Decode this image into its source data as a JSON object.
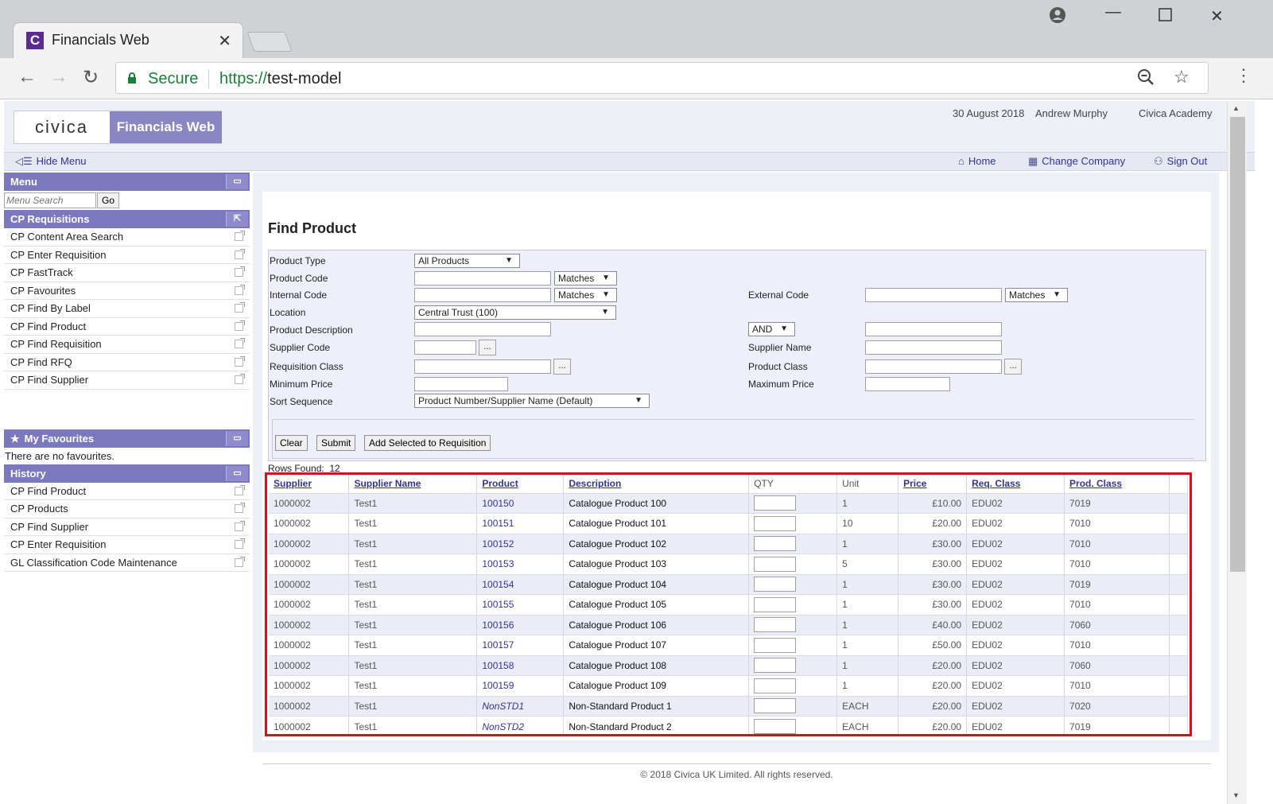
{
  "browser": {
    "tab_title": "Financials Web",
    "favicon_letter": "C",
    "secure_label": "Secure",
    "url_scheme": "https://",
    "url_host": "test-model"
  },
  "header": {
    "logo_text": "civica",
    "app_name": "Financials Web",
    "date": "30 August 2018",
    "user": "Andrew Murphy",
    "company": "Civica Academy"
  },
  "navbar": {
    "hide_menu": "Hide Menu",
    "home": "Home",
    "change_company": "Change Company",
    "sign_out": "Sign Out"
  },
  "sidebar": {
    "menu_title": "Menu",
    "search_placeholder": "Menu Search",
    "go_label": "Go",
    "requisitions_title": "CP Requisitions",
    "requisitions_items": [
      "CP Content Area Search",
      "CP Enter Requisition",
      "CP FastTrack",
      "CP Favourites",
      "CP Find By Label",
      "CP Find Product",
      "CP Find Requisition",
      "CP Find RFQ",
      "CP Find Supplier"
    ],
    "favourites_title": "My Favourites",
    "favourites_empty": "There are no favourites.",
    "history_title": "History",
    "history_items": [
      "CP Find Product",
      "CP Products",
      "CP Find Supplier",
      "CP Enter Requisition",
      "GL Classification Code Maintenance"
    ]
  },
  "form": {
    "title": "Find Product",
    "labels": {
      "product_type": "Product Type",
      "product_code": "Product Code",
      "internal_code": "Internal Code",
      "location": "Location",
      "product_description": "Product Description",
      "supplier_code": "Supplier Code",
      "requisition_class": "Requisition Class",
      "minimum_price": "Minimum Price",
      "sort_sequence": "Sort Sequence",
      "external_code": "External Code",
      "supplier_name": "Supplier Name",
      "product_class": "Product Class",
      "maximum_price": "Maximum Price"
    },
    "values": {
      "product_type": "All Products",
      "product_code_match": "Matches",
      "internal_code_match": "Matches",
      "external_code_match": "Matches",
      "location": "Central Trust (100)",
      "description_op": "AND",
      "sort_sequence": "Product Number/Supplier Name (Default)",
      "dots": "..."
    },
    "buttons": {
      "clear": "Clear",
      "submit": "Submit",
      "add_selected": "Add Selected to Requisition"
    },
    "rows_found_label": "Rows Found:",
    "rows_found_value": "12"
  },
  "table": {
    "headers": [
      "Supplier",
      "Supplier Name",
      "Product",
      "Description",
      "QTY",
      "Unit",
      "Price",
      "Req. Class",
      "Prod. Class"
    ],
    "rows": [
      [
        "1000002",
        "Test1",
        "100150",
        "Catalogue Product 100",
        "",
        "1",
        "£10.00",
        "EDU02",
        "7019"
      ],
      [
        "1000002",
        "Test1",
        "100151",
        "Catalogue Product 101",
        "",
        "10",
        "£20.00",
        "EDU02",
        "7010"
      ],
      [
        "1000002",
        "Test1",
        "100152",
        "Catalogue Product 102",
        "",
        "1",
        "£30.00",
        "EDU02",
        "7010"
      ],
      [
        "1000002",
        "Test1",
        "100153",
        "Catalogue Product 103",
        "",
        "5",
        "£30.00",
        "EDU02",
        "7010"
      ],
      [
        "1000002",
        "Test1",
        "100154",
        "Catalogue Product 104",
        "",
        "1",
        "£30.00",
        "EDU02",
        "7019"
      ],
      [
        "1000002",
        "Test1",
        "100155",
        "Catalogue Product 105",
        "",
        "1",
        "£30.00",
        "EDU02",
        "7010"
      ],
      [
        "1000002",
        "Test1",
        "100156",
        "Catalogue Product 106",
        "",
        "1",
        "£40.00",
        "EDU02",
        "7060"
      ],
      [
        "1000002",
        "Test1",
        "100157",
        "Catalogue Product 107",
        "",
        "1",
        "£50.00",
        "EDU02",
        "7010"
      ],
      [
        "1000002",
        "Test1",
        "100158",
        "Catalogue Product 108",
        "",
        "1",
        "£20.00",
        "EDU02",
        "7060"
      ],
      [
        "1000002",
        "Test1",
        "100159",
        "Catalogue Product 109",
        "",
        "1",
        "£20.00",
        "EDU02",
        "7010"
      ],
      [
        "1000002",
        "Test1",
        "NonSTD1",
        "Non-Standard Product 1",
        "",
        "EACH",
        "£20.00",
        "EDU02",
        "7020"
      ],
      [
        "1000002",
        "Test1",
        "NonSTD2",
        "Non-Standard Product 2",
        "",
        "EACH",
        "£20.00",
        "EDU02",
        "7019"
      ]
    ]
  },
  "footer": "© 2018 Civica UK Limited. All rights reserved.",
  "colors": {
    "accent": "#7c78bd",
    "link": "#333399",
    "highlight_frame": "#d4121f"
  }
}
